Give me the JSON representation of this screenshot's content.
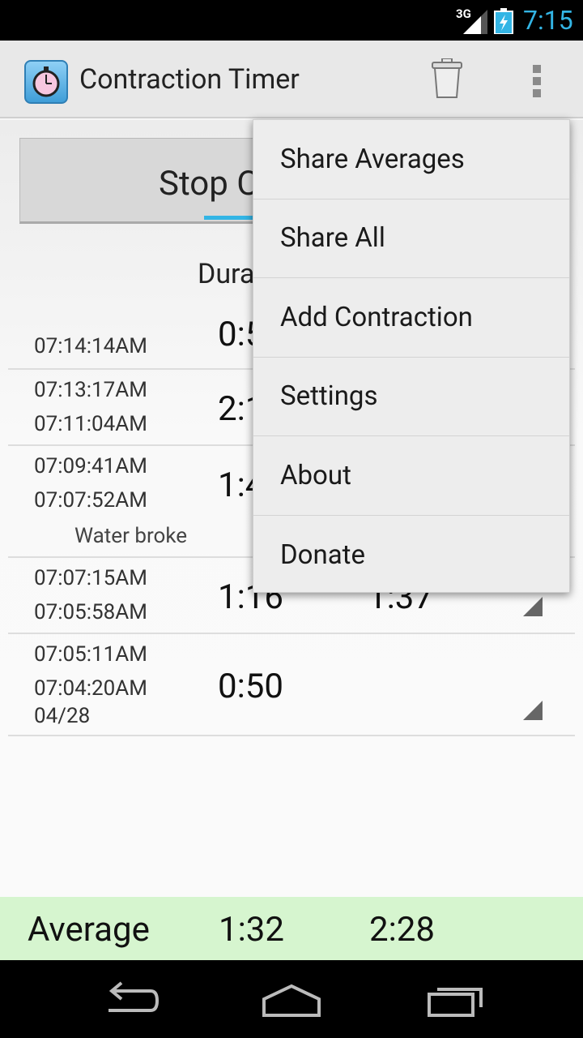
{
  "status_bar": {
    "network": "3G",
    "time": "7:15"
  },
  "action_bar": {
    "title": "Contraction Timer"
  },
  "main": {
    "stop_button_label": "Stop C",
    "column_header_partial": "Dura",
    "rows": [
      {
        "start": "",
        "end": "07:14:14AM",
        "duration": "0:5",
        "interval": "",
        "note": "",
        "date": ""
      },
      {
        "start": "07:13:17AM",
        "end": "07:11:04AM",
        "duration": "2:1",
        "interval": "",
        "note": "",
        "date": ""
      },
      {
        "start": "07:09:41AM",
        "end": "07:07:52AM",
        "duration": "1:4",
        "interval": "",
        "note": "Water broke",
        "date": ""
      },
      {
        "start": "07:07:15AM",
        "end": "07:05:58AM",
        "duration": "1:16",
        "interval": "1:37",
        "note": "",
        "date": ""
      },
      {
        "start": "07:05:11AM",
        "end": "07:04:20AM",
        "duration": "0:50",
        "interval": "",
        "note": "",
        "date": "04/28"
      }
    ]
  },
  "footer": {
    "label": "Average",
    "avg_duration": "1:32",
    "avg_interval": "2:28"
  },
  "menu": {
    "items": [
      {
        "label": "Share Averages"
      },
      {
        "label": "Share All"
      },
      {
        "label": "Add Contraction"
      },
      {
        "label": "Settings"
      },
      {
        "label": "About"
      },
      {
        "label": "Donate"
      }
    ]
  },
  "colors": {
    "accent": "#33b5e5",
    "footer_bg": "#d6f5cf",
    "status_bar": "#000000",
    "menu_bg": "#ededed"
  },
  "icons": [
    "signal-icon",
    "battery-icon",
    "stopwatch-app-icon",
    "trash-icon",
    "overflow-menu-icon",
    "back-icon",
    "home-icon",
    "recents-icon",
    "expand-triangle-icon"
  ]
}
